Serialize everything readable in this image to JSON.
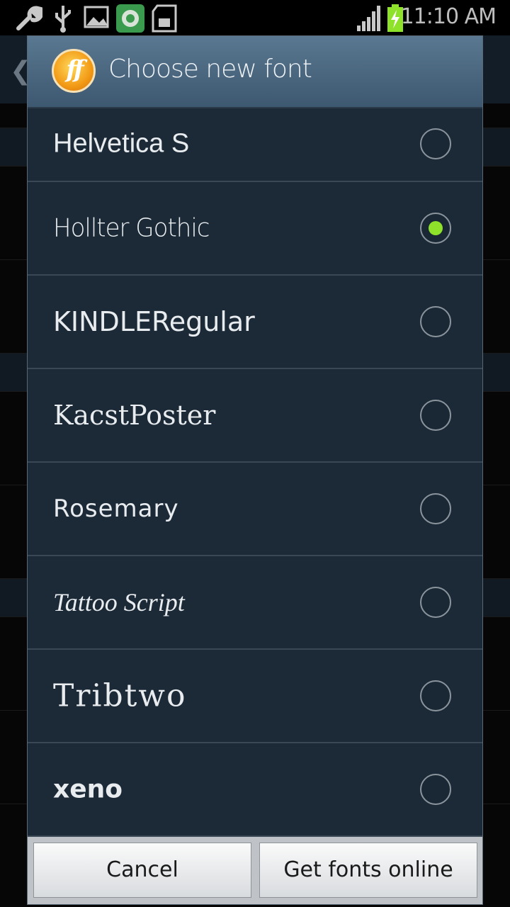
{
  "status_bar": {
    "time": "11:10 AM",
    "icons": [
      "wrench-icon",
      "usb-icon",
      "image-icon",
      "app-notification-icon",
      "sd-card-icon",
      "signal-icon",
      "battery-charging-icon"
    ]
  },
  "dialog": {
    "title": "Choose new font",
    "logo_text": "ff",
    "fonts": [
      {
        "label": "Helvetica S",
        "selected": false
      },
      {
        "label": "Hollter Gothic",
        "selected": true
      },
      {
        "label": "KINDLERegular",
        "selected": false
      },
      {
        "label": "KacstPoster",
        "selected": false
      },
      {
        "label": "Rosemary",
        "selected": false
      },
      {
        "label": "Tattoo Script",
        "selected": false
      },
      {
        "label": "Tribtwo",
        "selected": false
      },
      {
        "label": "xeno",
        "selected": false
      }
    ],
    "buttons": {
      "cancel": "Cancel",
      "get_fonts": "Get fonts online"
    }
  },
  "colors": {
    "accent": "#8ee22a",
    "dialog_bg": "#1c2a38",
    "header_bg": "#4b6780"
  }
}
